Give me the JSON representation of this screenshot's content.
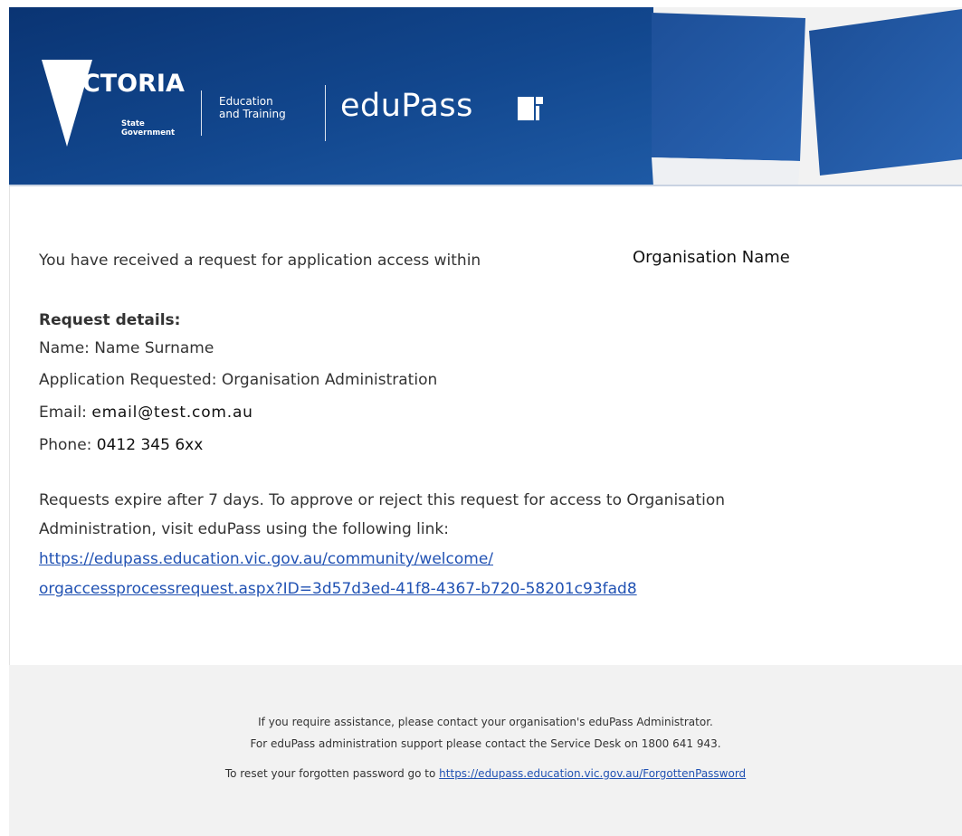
{
  "header": {
    "logo_victoria": "VICTORIA",
    "logo_state": "State",
    "logo_government": "Government",
    "dept_line1": "Education",
    "dept_line2": "and Training",
    "brand": "eduPass",
    "colors": {
      "banner_dark": "#0b3a78",
      "banner_mid": "#1f5aa3",
      "banner_light": "#f2f2f2"
    }
  },
  "message": {
    "intro": "You have received a request for application access within",
    "organisation": "Organisation Name",
    "details_heading": "Request details:",
    "name_label": "Name:",
    "name_value": "Name Surname",
    "application_label": "Application Requested:",
    "application_value": "Organisation Administration",
    "email_label": "Email:",
    "email_value": "email@test.com.au",
    "phone_label": "Phone:",
    "phone_value": "0412 345 6xx",
    "expiry_line1": "Requests expire after 7 days. To approve or reject this request for access to Organisation",
    "expiry_line2": "Administration, visit eduPass using the following link:",
    "request_link_line1": "https://edupass.education.vic.gov.au/community/welcome/",
    "request_link_line2": "orgaccessprocessrequest.aspx?ID=3d57d3ed-41f8-4367-b720-58201c93fad8"
  },
  "footer": {
    "assist_line": "If you require assistance, please contact your organisation's eduPass Administrator.",
    "support_line": "For eduPass administration support please contact the Service Desk on 1800 641 943.",
    "reset_prefix": "To reset your forgotten password go to",
    "reset_link": "https://edupass.education.vic.gov.au/ForgottenPassword",
    "link_color": "#2152b3"
  }
}
